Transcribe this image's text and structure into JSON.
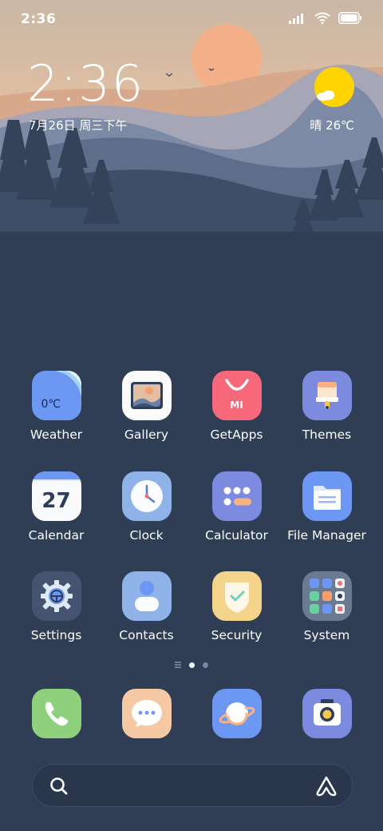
{
  "status_bar": {
    "time": "2:36"
  },
  "lockscreen": {
    "clock": "2:36",
    "date": "7月26日 周三下午",
    "weather": {
      "text": "晴 26℃"
    }
  },
  "apps": [
    {
      "label": "Weather",
      "icon": "weather-icon",
      "badge": "0℃"
    },
    {
      "label": "Gallery",
      "icon": "gallery-icon"
    },
    {
      "label": "GetApps",
      "icon": "getapps-icon",
      "badge": "MI"
    },
    {
      "label": "Themes",
      "icon": "themes-icon"
    },
    {
      "label": "Calendar",
      "icon": "calendar-icon",
      "badge": "27"
    },
    {
      "label": "Clock",
      "icon": "clock-icon"
    },
    {
      "label": "Calculator",
      "icon": "calculator-icon"
    },
    {
      "label": "File Manager",
      "icon": "folder-icon"
    },
    {
      "label": "Settings",
      "icon": "gear-icon"
    },
    {
      "label": "Contacts",
      "icon": "contacts-icon"
    },
    {
      "label": "Security",
      "icon": "shield-icon"
    },
    {
      "label": "System",
      "icon": "system-folder-icon"
    }
  ],
  "page_indicator": {
    "pages": 3,
    "current": 2
  },
  "dock": [
    {
      "name": "phone",
      "icon": "phone-icon"
    },
    {
      "name": "messages",
      "icon": "message-icon"
    },
    {
      "name": "browser",
      "icon": "planet-icon"
    },
    {
      "name": "camera",
      "icon": "camera-icon"
    }
  ],
  "search": {
    "icon": "search-icon",
    "assistant_icon": "assistant-icon"
  },
  "colors": {
    "background": "#2f3d55",
    "sky": "#e8c1a0",
    "sun": "#f3b28b",
    "weather_sun": "#ffd400"
  }
}
